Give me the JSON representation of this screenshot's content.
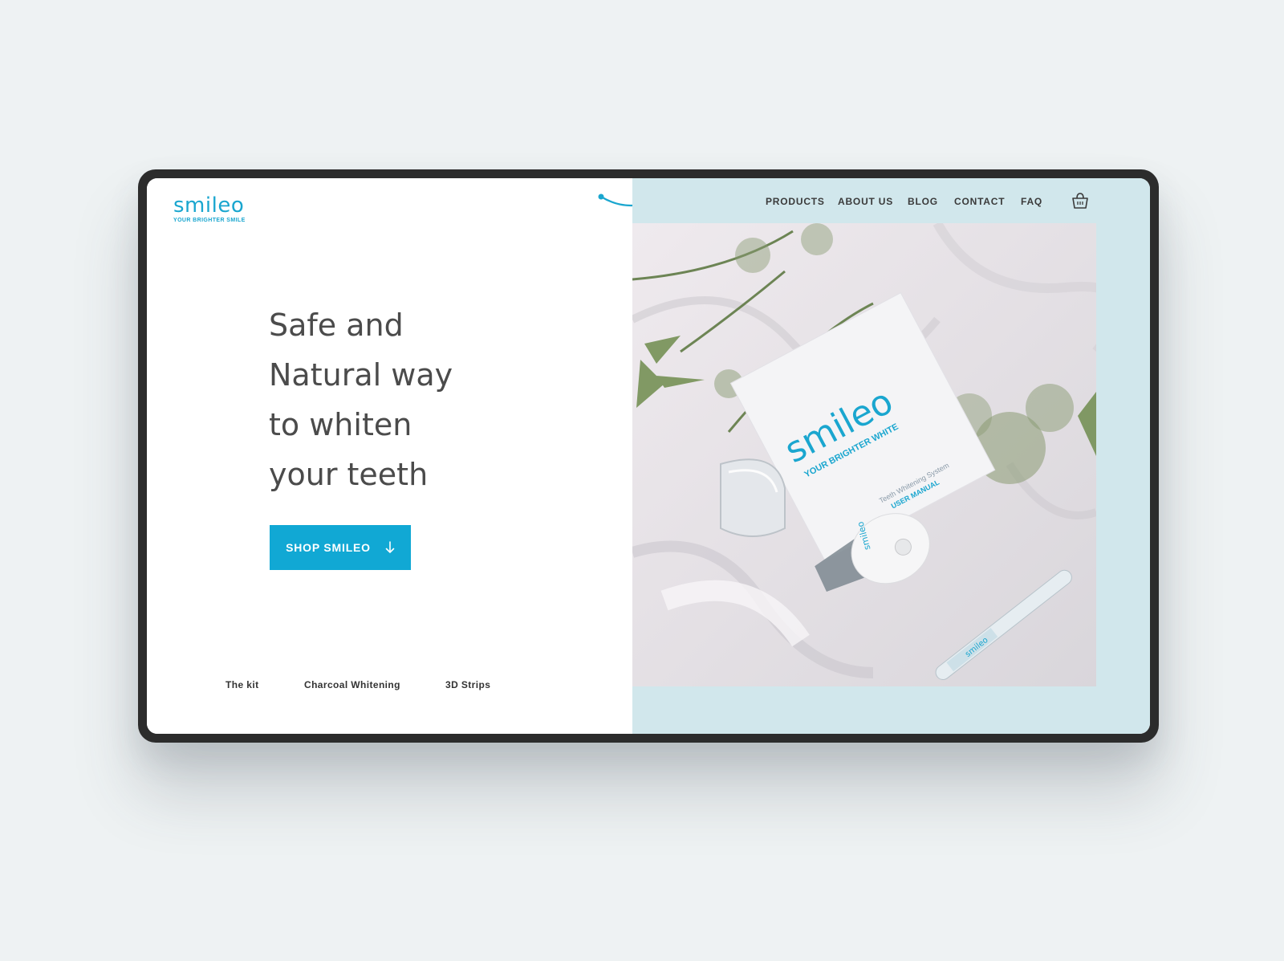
{
  "brand": {
    "name": "smileo",
    "tagline": "YOUR BRIGHTER SMILE",
    "accent": "#1aa6cf",
    "highlight_green": "#a3c85e",
    "panel_bg": "#d1e7ec"
  },
  "nav": {
    "items": [
      "PRODUCTS",
      "ABOUT US",
      "BLOG",
      "CONTACT",
      "FAQ"
    ],
    "cart_icon": "shopping-basket-icon"
  },
  "hero": {
    "headline_lines": [
      {
        "underlined": "Safe",
        "rest": " and"
      },
      {
        "underlined": "Natural",
        "rest": " way"
      },
      {
        "underlined": "",
        "rest": "to whiten"
      },
      {
        "underlined": "",
        "rest": "your teeth"
      }
    ],
    "cta_label": "SHOP SMILEO",
    "cta_icon": "arrow-down-icon"
  },
  "product_links": [
    "The kit",
    "Charcoal Whitening",
    "3D Strips"
  ],
  "photo": {
    "box_brand": "smileo",
    "box_tagline": "YOUR BRIGHTER WHITE",
    "box_subtitle": "Teeth Whitening System",
    "box_manual": "USER MANUAL",
    "device_label": "smileo",
    "pen_label": "smileo"
  }
}
